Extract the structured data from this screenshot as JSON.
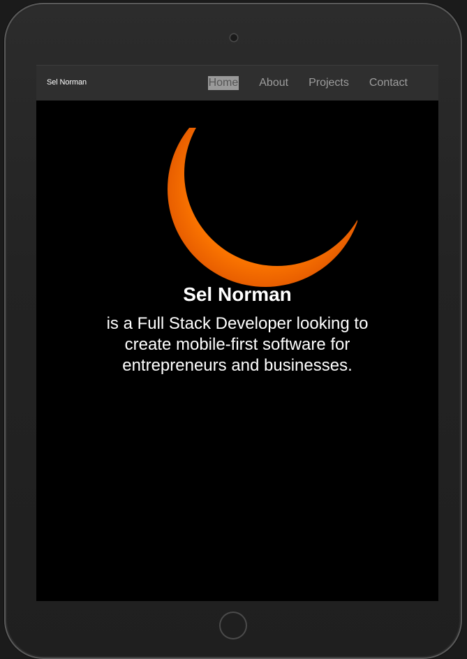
{
  "navbar": {
    "brand": "Sel Norman",
    "links": [
      {
        "label": "Home",
        "active": true
      },
      {
        "label": "About"
      },
      {
        "label": "Projects"
      },
      {
        "label": "Contact"
      }
    ]
  },
  "hero": {
    "name": "Sel Norman",
    "tagline": "is a Full Stack Developer looking to create mobile-first software for entrepreneurs and businesses.",
    "image": "crescent-eclipse-sun"
  },
  "colors": {
    "navbar_bg": "#2f2f2f",
    "nav_link": "#9d9d9d",
    "active_link_bg": "#9a9a9a",
    "hero_bg": "#000000",
    "crescent": "#ff7a00",
    "text": "#ffffff"
  }
}
